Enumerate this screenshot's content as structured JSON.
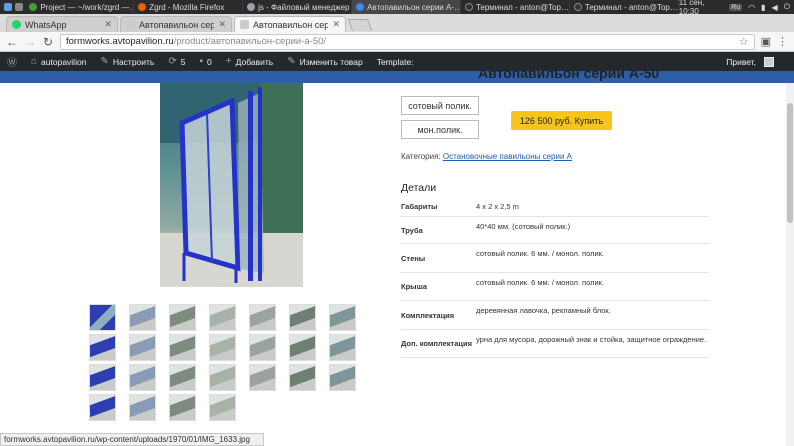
{
  "taskbar": {
    "tasks": [
      {
        "label": "Project — ~/work/zgrd —…",
        "color": "#4a9b3c"
      },
      {
        "label": "Zgrd - Mozilla Firefox",
        "color": "#e66000"
      },
      {
        "label": "js - Файловый менеджер",
        "color": "#9aa3ad"
      },
      {
        "label": "Автопавильон серии А-…",
        "color": "#4285f4"
      },
      {
        "label": "Терминал - anton@Top…",
        "color": "#333333"
      },
      {
        "label": "Терминал - anton@Top…",
        "color": "#333333"
      }
    ],
    "clock": "11 сен, 10:30",
    "keyboard": "Ru"
  },
  "browser": {
    "tabs": [
      {
        "label": "WhatsApp",
        "color": "#25d366"
      },
      {
        "label": "Автопавильон серии",
        "color": "#cccccc"
      },
      {
        "label": "Автопавильон серии",
        "color": "#cccccc"
      }
    ],
    "url_host": "formworks.avtopavilion.ru",
    "url_path": "/product/автопавильон-серии-а-50/"
  },
  "wp_admin_bar": {
    "site_name": "autopavilion",
    "customize": "Настроить",
    "updates_count": "5",
    "comments_count": "0",
    "add_new": "Добавить",
    "edit_product": "Изменить товар",
    "template": "Template:",
    "greeting": "Привет,"
  },
  "product": {
    "title": "Автопавильон серии А-50",
    "option_1": "сотовый полик.",
    "option_2": "мон.полик.",
    "buy_label": "126 500 руб. Купить",
    "category_label": "Категория:",
    "category_link": "Остановочные павильоны серии А",
    "details_title": "Детали",
    "specs": [
      {
        "key": "Габариты",
        "value": "4 x 2 x 2,5 m"
      },
      {
        "key": "Труба",
        "value": "40*40 мм. (сотовый полик.)"
      },
      {
        "key": "Стены",
        "value": "сотовый полик. 6 мм. / монол. полик."
      },
      {
        "key": "Крыша",
        "value": "сотовый полик. 6 мм. / монол. полик."
      },
      {
        "key": "Комплектация",
        "value": "деревянная лавочка, рекламный блок."
      },
      {
        "key": "Доп. комплектация",
        "value": "урна для мусора, дорожный знак и стойка, защитное ограждение."
      }
    ],
    "thumbnail_count": 25
  },
  "status_bar": "formworks.avtopavilion.ru/wp-content/uploads/1970/01/IMG_1633.jpg"
}
